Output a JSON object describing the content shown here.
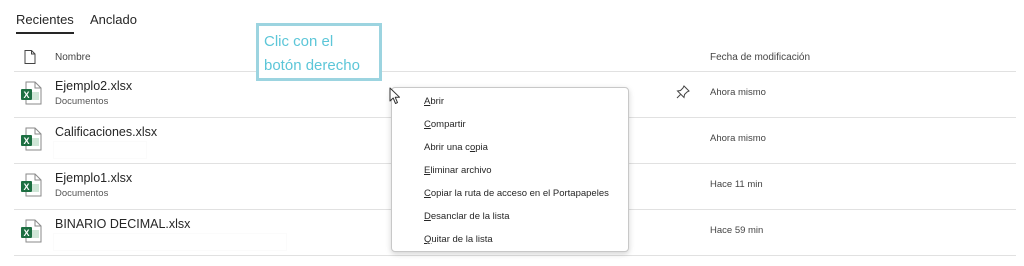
{
  "tabs": [
    {
      "label": "Recientes",
      "active": true
    },
    {
      "label": "Anclado",
      "active": false
    }
  ],
  "table": {
    "columns": {
      "name": "Nombre",
      "date": "Fecha de modificación"
    },
    "rows": [
      {
        "name": "Ejemplo2.xlsx",
        "location": "Documentos",
        "date": "Ahora mismo",
        "pinned": true,
        "icon": "excel-file-icon"
      },
      {
        "name": "Calificaciones.xlsx",
        "location": "",
        "date": "Ahora mismo",
        "pinned": false,
        "icon": "excel-file-icon"
      },
      {
        "name": "Ejemplo1.xlsx",
        "location": "Documentos",
        "date": "Hace 11 min",
        "pinned": false,
        "icon": "excel-file-icon"
      },
      {
        "name": "BINARIO DECIMAL.xlsx",
        "location": "",
        "date": "Hace 59 min",
        "pinned": false,
        "icon": "excel-file-icon"
      }
    ]
  },
  "callout": {
    "line1": "Clic con el",
    "line2": "botón derecho"
  },
  "context_menu": {
    "items": [
      {
        "key": "A",
        "rest": "brir"
      },
      {
        "key": "C",
        "rest": "ompartir"
      },
      {
        "pre": "Abrir una c",
        "key": "o",
        "rest": "pia"
      },
      {
        "key": "E",
        "rest": "liminar archivo"
      },
      {
        "key": "C",
        "rest": "opiar la ruta de acceso en el Portapapeles"
      },
      {
        "key": "D",
        "rest": "esanclar de la lista"
      },
      {
        "key": "Q",
        "rest": "uitar de la lista"
      }
    ]
  },
  "colors": {
    "excel_green": "#1d6f42",
    "callout_border": "#9cd4e0",
    "callout_text": "#5cc6d8"
  }
}
